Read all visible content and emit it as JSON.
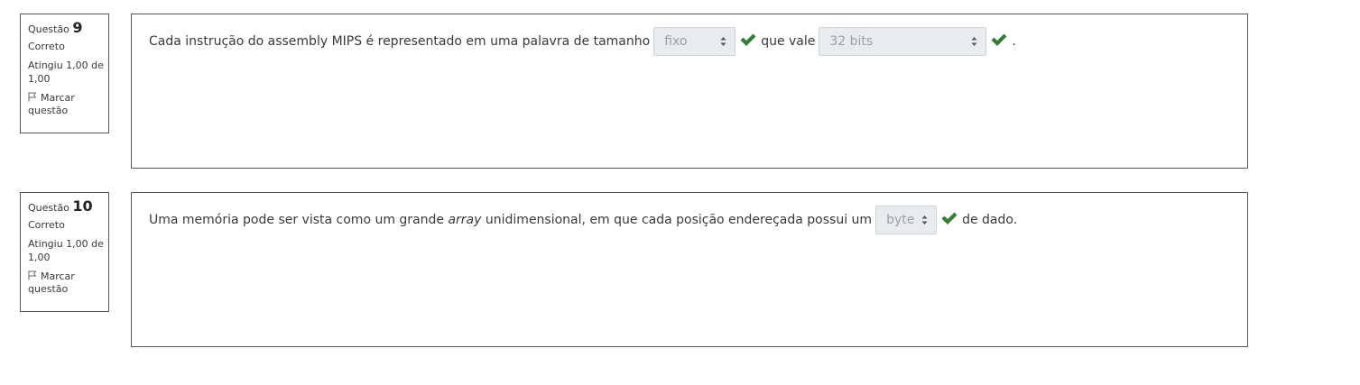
{
  "questions": [
    {
      "label": "Questão",
      "number": "9",
      "state": "Correto",
      "grade": "Atingiu 1,00 de 1,00",
      "flag_label": "Marcar questão",
      "text_before": "Cada instrução do assembly MIPS é representado em uma palavra de tamanho",
      "select1": "fixo",
      "text_middle": "que vale",
      "select2": "32 bits",
      "text_after": "."
    },
    {
      "label": "Questão",
      "number": "10",
      "state": "Correto",
      "grade": "Atingiu 1,00 de 1,00",
      "flag_label": "Marcar questão",
      "text_before": "Uma memória pode ser vista como um grande ",
      "text_italic": "array",
      "text_before2": " unidimensional, em que cada posição endereçada possui um",
      "select1": "byte",
      "text_after": "de dado."
    }
  ],
  "icons": {
    "check": "check-icon",
    "flag": "flag-icon",
    "select_arrows": "updown-arrows-icon"
  },
  "colors": {
    "check": "#3a7a3a",
    "select_bg": "#e9ecef",
    "border": "#555555"
  }
}
